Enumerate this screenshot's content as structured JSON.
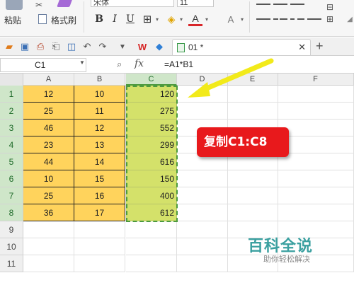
{
  "ribbon": {
    "paste_label": "粘贴",
    "format_painter_label": "格式刷",
    "font_name": "宋体",
    "font_size": "11",
    "bold": "B",
    "italic": "I",
    "underline": "U",
    "font_color_glyph": "A",
    "highlight_glyph": "A"
  },
  "toolbar": {
    "tab_title": "01 *"
  },
  "formula_bar": {
    "name_box": "C1",
    "fx": "fx",
    "formula": "=A1*B1"
  },
  "sheet": {
    "columns": [
      "A",
      "B",
      "C",
      "D",
      "E",
      "F"
    ],
    "selected_column": "C",
    "rows": [
      "1",
      "2",
      "3",
      "4",
      "5",
      "6",
      "7",
      "8",
      "9",
      "10",
      "11"
    ],
    "data": [
      {
        "a": "12",
        "b": "10",
        "c": "120"
      },
      {
        "a": "25",
        "b": "11",
        "c": "275"
      },
      {
        "a": "46",
        "b": "12",
        "c": "552"
      },
      {
        "a": "23",
        "b": "13",
        "c": "299"
      },
      {
        "a": "44",
        "b": "14",
        "c": "616"
      },
      {
        "a": "10",
        "b": "15",
        "c": "150"
      },
      {
        "a": "25",
        "b": "16",
        "c": "400"
      },
      {
        "a": "36",
        "b": "17",
        "c": "612"
      }
    ]
  },
  "annotation": {
    "callout_text": "复制C1:C8",
    "callout_color": "#e8191c",
    "arrow_color": "#f2ea1a"
  },
  "watermark": {
    "title": "百科全说",
    "subtitle": "助你轻松解决"
  },
  "colors": {
    "data_fill": "#ffd35c",
    "result_fill": "#d4e16a",
    "selection": "#4c9a3e"
  }
}
